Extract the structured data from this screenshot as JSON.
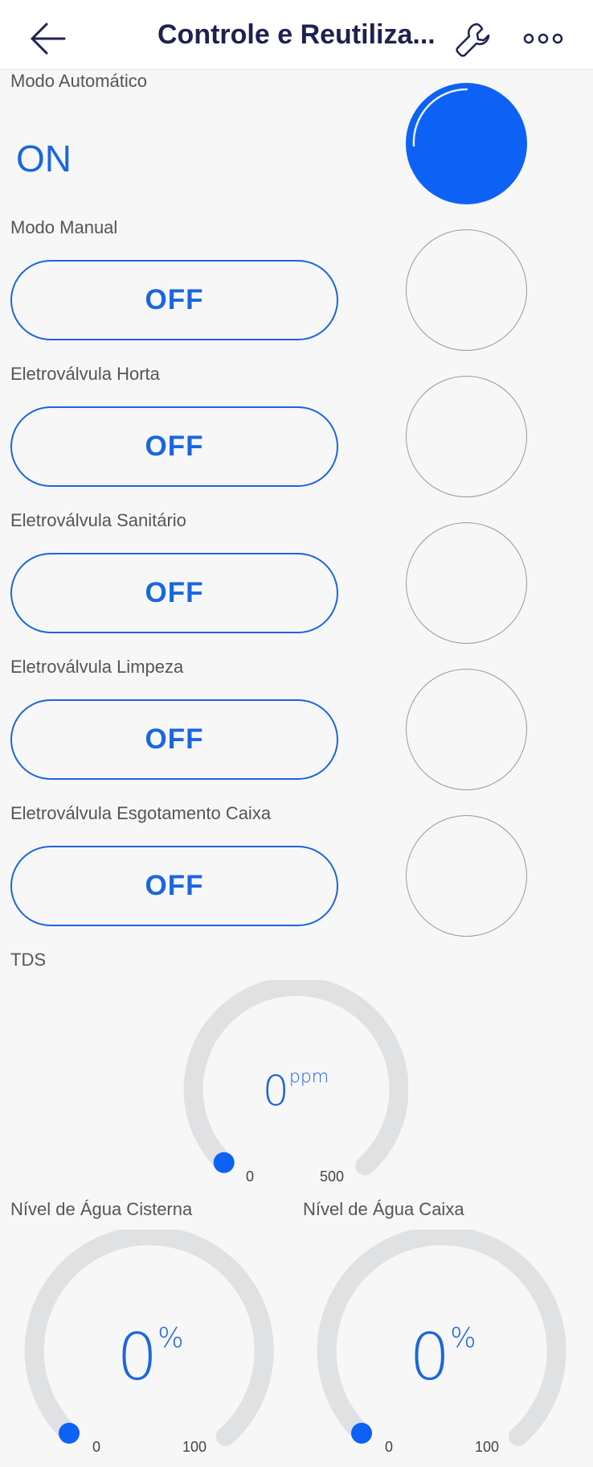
{
  "header": {
    "title": "Controle e Reutiliza...",
    "back_icon": "arrow-left-icon",
    "settings_icon": "wrench-icon",
    "menu_icon": "more-dots-icon"
  },
  "auto_mode": {
    "label": "Modo Automático",
    "state": "ON",
    "led_on": true
  },
  "controls": [
    {
      "label": "Modo Manual",
      "button": "OFF",
      "led_on": false
    },
    {
      "label": "Eletroválvula Horta",
      "button": "OFF",
      "led_on": false
    },
    {
      "label": "Eletroválvula Sanitário",
      "button": "OFF",
      "led_on": false
    },
    {
      "label": "Eletroválvula Limpeza",
      "button": "OFF",
      "led_on": false
    },
    {
      "label": "Eletroválvula Esgotamento Caixa",
      "button": "OFF",
      "led_on": false
    }
  ],
  "gauges": {
    "tds": {
      "label": "TDS",
      "value": "0",
      "unit": "ppm",
      "min": "0",
      "max": "500",
      "fraction": 0
    },
    "cisterna": {
      "label": "Nível de Água Cisterna",
      "value": "0",
      "unit": "%",
      "min": "0",
      "max": "100",
      "fraction": 0
    },
    "caixa": {
      "label": "Nível de Água Caixa",
      "value": "0",
      "unit": "%",
      "min": "0",
      "max": "100",
      "fraction": 0
    }
  },
  "colors": {
    "accent": "#1a66e0",
    "led_on": "#0d62f5",
    "gauge_track": "#e0e1e3",
    "title": "#1f2150"
  }
}
